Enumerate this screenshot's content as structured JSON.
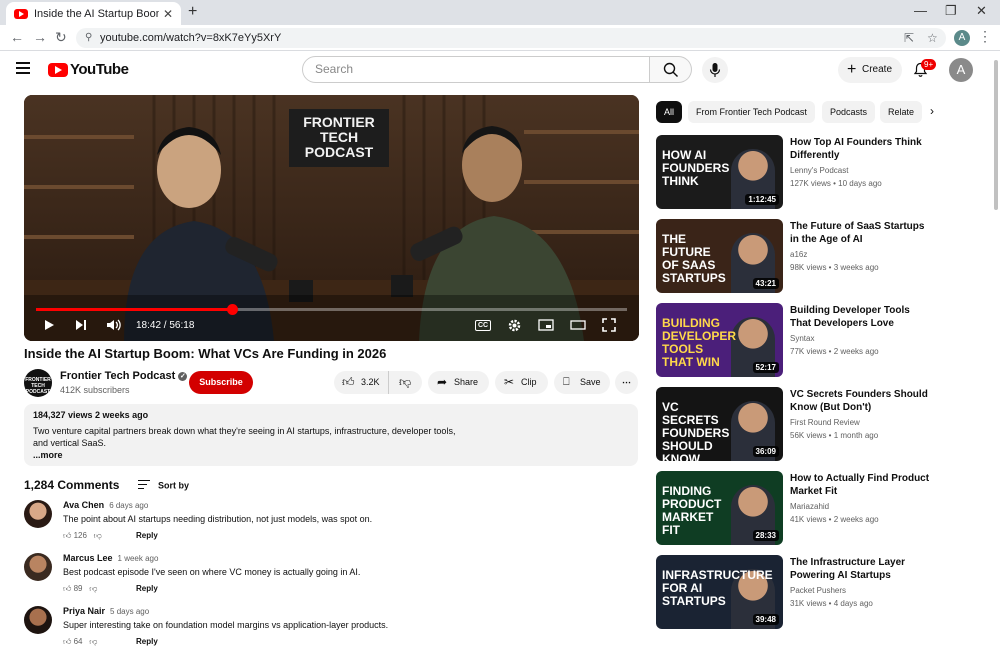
{
  "browser": {
    "tab_title": "Inside the AI Startup Boom: Wh...",
    "tab_close": "✕",
    "new_tab": "+",
    "url": "youtube.com/watch?v=8xK7eYy5XrY",
    "profile_initial": "A"
  },
  "header": {
    "logo_text": "YouTube",
    "search_placeholder": "Search",
    "create_label": "Create",
    "notification_count": "9+",
    "avatar_initial": "A"
  },
  "video": {
    "sign_text": "FRONTIER TECH PODCAST",
    "time": "18:42 / 56:18",
    "progress": 0.332,
    "cc": "CC",
    "title": "Inside the AI Startup Boom: What VCs Are Funding in 2026"
  },
  "channel": {
    "logo_text": "FRONTIER TECH PODCAST",
    "name": "Frontier Tech Podcast",
    "subscribers": "412K subscribers",
    "subscribe_label": "Subscribe"
  },
  "actions": {
    "likes": "3.2K",
    "share": "Share",
    "clip": "Clip",
    "save": "Save"
  },
  "description": {
    "meta": "184,327 views  2 weeks ago",
    "text": "Two venture capital partners break down what they're seeing in AI startups, infrastructure, developer tools, and vertical SaaS.",
    "more": "...more"
  },
  "comments": {
    "count": "1,284 Comments",
    "sort_label": "Sort by",
    "reply_label": "Reply",
    "items": [
      {
        "author": "Ava Chen",
        "ago": "6 days ago",
        "text": "The point about AI startups needing distribution, not just models, was spot on.",
        "likes": "126"
      },
      {
        "author": "Marcus Lee",
        "ago": "1 week ago",
        "text": "Best podcast episode I've seen on where VC money is actually going in AI.",
        "likes": "89"
      },
      {
        "author": "Priya Nair",
        "ago": "5 days ago",
        "text": "Super interesting take on foundation model margins vs application-layer products.",
        "likes": "64"
      }
    ]
  },
  "chips": [
    "All",
    "From Frontier Tech Podcast",
    "Podcasts",
    "Relate"
  ],
  "recommendations": [
    {
      "thumb_text": "HOW AI FOUNDERS THINK",
      "duration": "1:12:45",
      "title": "How Top AI Founders Think Differently",
      "channel": "Lenny's Podcast",
      "views": "127K views • 10 days ago",
      "bg": "#1b1b1b",
      "text_color": "#ffffff"
    },
    {
      "thumb_text": "THE FUTURE OF SAAS STARTUPS",
      "duration": "43:21",
      "title": "The Future of SaaS Startups in the Age of AI",
      "channel": "a16z",
      "views": "98K views • 3 weeks ago",
      "bg": "#3a2418",
      "text_color": "#ffffff"
    },
    {
      "thumb_text": "BUILDING DEVELOPER TOOLS THAT WIN",
      "duration": "52:17",
      "title": "Building Developer Tools That Developers Love",
      "channel": "Syntax",
      "views": "77K views • 2 weeks ago",
      "bg": "#4b1f7a",
      "text_color": "#ffd84a"
    },
    {
      "thumb_text": "VC SECRETS FOUNDERS SHOULD KNOW",
      "duration": "36:09",
      "title": "VC Secrets Founders Should Know (But Don't)",
      "channel": "First Round Review",
      "views": "56K views • 1 month ago",
      "bg": "#141414",
      "text_color": "#ffffff"
    },
    {
      "thumb_text": "FINDING PRODUCT MARKET FIT",
      "duration": "28:33",
      "title": "How to Actually Find Product Market Fit",
      "channel": "Mariazahid",
      "views": "41K views • 2 weeks ago",
      "bg": "#0f3d23",
      "text_color": "#ffffff"
    },
    {
      "thumb_text": "INFRASTRUCTURE FOR AI STARTUPS",
      "duration": "39:48",
      "title": "The Infrastructure Layer Powering AI Startups",
      "channel": "Packet Pushers",
      "views": "31K views • 4 days ago",
      "bg": "#1a2333",
      "text_color": "#ffffff"
    }
  ]
}
